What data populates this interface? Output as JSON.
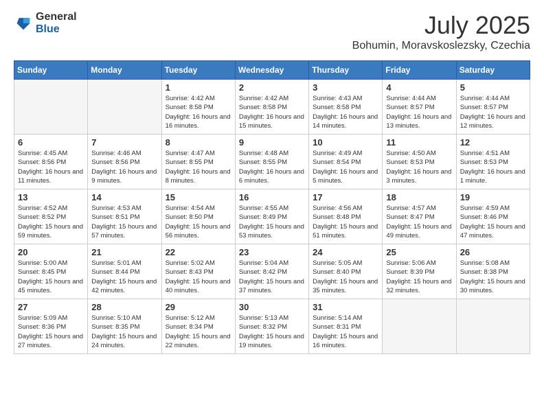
{
  "header": {
    "logo_general": "General",
    "logo_blue": "Blue",
    "month_title": "July 2025",
    "location": "Bohumin, Moravskoslezsky, Czechia"
  },
  "days_of_week": [
    "Sunday",
    "Monday",
    "Tuesday",
    "Wednesday",
    "Thursday",
    "Friday",
    "Saturday"
  ],
  "weeks": [
    [
      {
        "day": "",
        "empty": true
      },
      {
        "day": "",
        "empty": true
      },
      {
        "day": "1",
        "sunrise": "4:42 AM",
        "sunset": "8:58 PM",
        "daylight": "16 hours and 16 minutes."
      },
      {
        "day": "2",
        "sunrise": "4:42 AM",
        "sunset": "8:58 PM",
        "daylight": "16 hours and 15 minutes."
      },
      {
        "day": "3",
        "sunrise": "4:43 AM",
        "sunset": "8:58 PM",
        "daylight": "16 hours and 14 minutes."
      },
      {
        "day": "4",
        "sunrise": "4:44 AM",
        "sunset": "8:57 PM",
        "daylight": "16 hours and 13 minutes."
      },
      {
        "day": "5",
        "sunrise": "4:44 AM",
        "sunset": "8:57 PM",
        "daylight": "16 hours and 12 minutes."
      }
    ],
    [
      {
        "day": "6",
        "sunrise": "4:45 AM",
        "sunset": "8:56 PM",
        "daylight": "16 hours and 11 minutes."
      },
      {
        "day": "7",
        "sunrise": "4:46 AM",
        "sunset": "8:56 PM",
        "daylight": "16 hours and 9 minutes."
      },
      {
        "day": "8",
        "sunrise": "4:47 AM",
        "sunset": "8:55 PM",
        "daylight": "16 hours and 8 minutes."
      },
      {
        "day": "9",
        "sunrise": "4:48 AM",
        "sunset": "8:55 PM",
        "daylight": "16 hours and 6 minutes."
      },
      {
        "day": "10",
        "sunrise": "4:49 AM",
        "sunset": "8:54 PM",
        "daylight": "16 hours and 5 minutes."
      },
      {
        "day": "11",
        "sunrise": "4:50 AM",
        "sunset": "8:53 PM",
        "daylight": "16 hours and 3 minutes."
      },
      {
        "day": "12",
        "sunrise": "4:51 AM",
        "sunset": "8:53 PM",
        "daylight": "16 hours and 1 minute."
      }
    ],
    [
      {
        "day": "13",
        "sunrise": "4:52 AM",
        "sunset": "8:52 PM",
        "daylight": "15 hours and 59 minutes."
      },
      {
        "day": "14",
        "sunrise": "4:53 AM",
        "sunset": "8:51 PM",
        "daylight": "15 hours and 57 minutes."
      },
      {
        "day": "15",
        "sunrise": "4:54 AM",
        "sunset": "8:50 PM",
        "daylight": "15 hours and 56 minutes."
      },
      {
        "day": "16",
        "sunrise": "4:55 AM",
        "sunset": "8:49 PM",
        "daylight": "15 hours and 53 minutes."
      },
      {
        "day": "17",
        "sunrise": "4:56 AM",
        "sunset": "8:48 PM",
        "daylight": "15 hours and 51 minutes."
      },
      {
        "day": "18",
        "sunrise": "4:57 AM",
        "sunset": "8:47 PM",
        "daylight": "15 hours and 49 minutes."
      },
      {
        "day": "19",
        "sunrise": "4:59 AM",
        "sunset": "8:46 PM",
        "daylight": "15 hours and 47 minutes."
      }
    ],
    [
      {
        "day": "20",
        "sunrise": "5:00 AM",
        "sunset": "8:45 PM",
        "daylight": "15 hours and 45 minutes."
      },
      {
        "day": "21",
        "sunrise": "5:01 AM",
        "sunset": "8:44 PM",
        "daylight": "15 hours and 42 minutes."
      },
      {
        "day": "22",
        "sunrise": "5:02 AM",
        "sunset": "8:43 PM",
        "daylight": "15 hours and 40 minutes."
      },
      {
        "day": "23",
        "sunrise": "5:04 AM",
        "sunset": "8:42 PM",
        "daylight": "15 hours and 37 minutes."
      },
      {
        "day": "24",
        "sunrise": "5:05 AM",
        "sunset": "8:40 PM",
        "daylight": "15 hours and 35 minutes."
      },
      {
        "day": "25",
        "sunrise": "5:06 AM",
        "sunset": "8:39 PM",
        "daylight": "15 hours and 32 minutes."
      },
      {
        "day": "26",
        "sunrise": "5:08 AM",
        "sunset": "8:38 PM",
        "daylight": "15 hours and 30 minutes."
      }
    ],
    [
      {
        "day": "27",
        "sunrise": "5:09 AM",
        "sunset": "8:36 PM",
        "daylight": "15 hours and 27 minutes."
      },
      {
        "day": "28",
        "sunrise": "5:10 AM",
        "sunset": "8:35 PM",
        "daylight": "15 hours and 24 minutes."
      },
      {
        "day": "29",
        "sunrise": "5:12 AM",
        "sunset": "8:34 PM",
        "daylight": "15 hours and 22 minutes."
      },
      {
        "day": "30",
        "sunrise": "5:13 AM",
        "sunset": "8:32 PM",
        "daylight": "15 hours and 19 minutes."
      },
      {
        "day": "31",
        "sunrise": "5:14 AM",
        "sunset": "8:31 PM",
        "daylight": "15 hours and 16 minutes."
      },
      {
        "day": "",
        "empty": true
      },
      {
        "day": "",
        "empty": true
      }
    ]
  ]
}
